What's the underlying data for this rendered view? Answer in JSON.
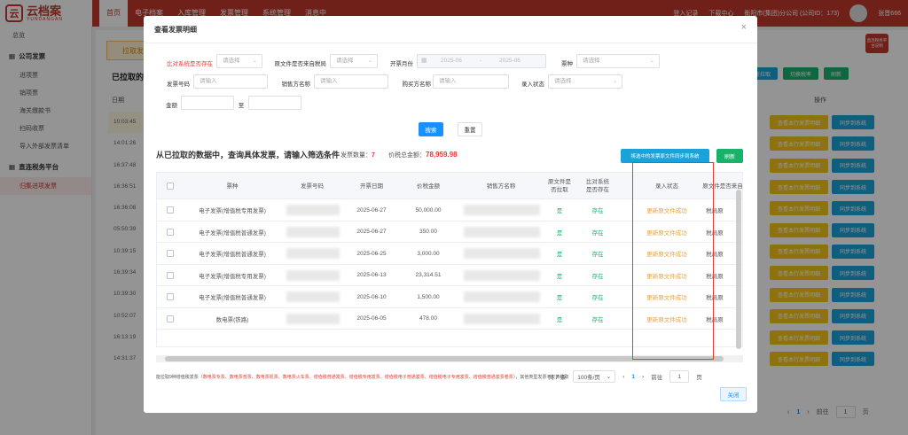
{
  "app": {
    "logo_mark": "云",
    "logo_text": "云档案",
    "logo_sub": "YUNDANGAN",
    "nav": [
      "首页",
      "电子档案",
      "入库管理",
      "发票管理",
      "系统管理",
      "消息中"
    ],
    "nav_active": "首页",
    "right": {
      "login_record": "登入记录",
      "download_center": "下载中心",
      "company": "衡阳市(集团)分公司 (公司ID：173)",
      "user": "张晋666"
    }
  },
  "sidebar": {
    "first": "总览",
    "groups": [
      {
        "label": "公司发票",
        "items": [
          "进项票",
          "销项票",
          "海关缴款书",
          "扫码收票",
          "导入外部发票清单"
        ]
      },
      {
        "label": "直连税务平台",
        "items": [
          "归集进项发票"
        ]
      }
    ],
    "active_item": "归集进项发票"
  },
  "background": {
    "tab": "拉取发",
    "title": "已拉取的",
    "col_time": "日期",
    "col_op": "操作",
    "times": [
      "10:03:45",
      "14:01:26",
      "16:37:48",
      "16:36:51",
      "16:36:08",
      "05:50:39",
      "10:39:15",
      "16:39:34",
      "10:39:30",
      "10:52:07",
      "16:13:19",
      "14:31:37"
    ],
    "btn_yellow": "查看本行发票明细",
    "btn_blue": "同步到系统",
    "top_btns": [
      {
        "label": "新拉取",
        "color": "#1aa3d9"
      },
      {
        "label": "切换税率",
        "color": "#19b26b"
      },
      {
        "label": "刷新",
        "color": "#19b26b"
      }
    ],
    "pager_page": "1",
    "pager_goto": "前往",
    "pager_unit": "页",
    "red_badge": "直连税务平台说明"
  },
  "modal": {
    "title": "查看发票明细",
    "close_icon": "×",
    "filters": {
      "compare_exists": {
        "label": "比对系统是否存在",
        "placeholder": "请选择"
      },
      "source_from_tax": {
        "label": "原文件是否来自税局",
        "placeholder": "请选择"
      },
      "issue_month": {
        "label": "开票月份",
        "from": "2025-06",
        "sep": "-",
        "to": "2025-06"
      },
      "invoice_type": {
        "label": "票种",
        "placeholder": "请选择"
      },
      "invoice_no": {
        "label": "发票号码",
        "placeholder": "请输入"
      },
      "seller_name": {
        "label": "销售方名称",
        "placeholder": "请输入"
      },
      "buyer_name": {
        "label": "购买方名称",
        "placeholder": "请输入"
      },
      "entry_status": {
        "label": "录入状态",
        "placeholder": "请选择"
      },
      "amount": {
        "label": "金额",
        "to": "至"
      }
    },
    "search_btn": "搜索",
    "reset_btn": "重置",
    "summary": {
      "title": "从已拉取的数据中，查询具体发票，请输入筛选条件",
      "count_label": "发票数量：",
      "count": "7",
      "total_label": "价税总金额：",
      "total": "78,959.98"
    },
    "export_btn": "将选中的发票原文件同步到系统",
    "green_btn": "刷新",
    "table": {
      "headers": [
        "票种",
        "发票号码",
        "开票日期",
        "价税金额",
        "销售方名称",
        "原文件是否拉取",
        "比对系统是否存在",
        "录入状态",
        "原文件是否来自"
      ],
      "rows": [
        {
          "type": "电子发票(增值税专用发票)",
          "date": "2025-06-27",
          "amount": "50,000.00",
          "pulled": "是",
          "exists": "存在",
          "status": "更新原文件成功",
          "source": "税局原"
        },
        {
          "type": "电子发票(增值税普通发票)",
          "date": "2025-06-27",
          "amount": "350.00",
          "pulled": "是",
          "exists": "存在",
          "status": "更新原文件成功",
          "source": "税局原"
        },
        {
          "type": "电子发票(增值税普通发票)",
          "date": "2025-06-25",
          "amount": "3,000.00",
          "pulled": "是",
          "exists": "存在",
          "status": "更新原文件成功",
          "source": "税局原"
        },
        {
          "type": "电子发票(增值税专用发票)",
          "date": "2025-06-13",
          "amount": "23,314.51",
          "pulled": "是",
          "exists": "存在",
          "status": "更新原文件成功",
          "source": "税局原"
        },
        {
          "type": "电子发票(增值税普通发票)",
          "date": "2025-06-10",
          "amount": "1,500.00",
          "pulled": "是",
          "exists": "存在",
          "status": "更新原文件成功",
          "source": "税局原"
        },
        {
          "type": "数电票(铁路)",
          "date": "2025-06-05",
          "amount": "478.00",
          "pulled": "是",
          "exists": "存在",
          "status": "更新原文件成功",
          "source": "税局原"
        }
      ]
    },
    "pager": {
      "total": "共 7 条",
      "page_size": "100条/页",
      "prev": "‹",
      "page": "1",
      "next": "›",
      "goto": "前往",
      "goto_value": "1",
      "unit": "页"
    },
    "note": {
      "prefix": "能拉取9种增值税发票（",
      "types": "数电票专票、数电票普票、数电票机票、数电票火车票、增值税普通发票、增值税专用发票、增值税电子普通发票、增值税电子专用发票、增值税普通发票卷票",
      "suffix": "），其他类型发票不支持拉取"
    },
    "close_btn": "关闭"
  }
}
